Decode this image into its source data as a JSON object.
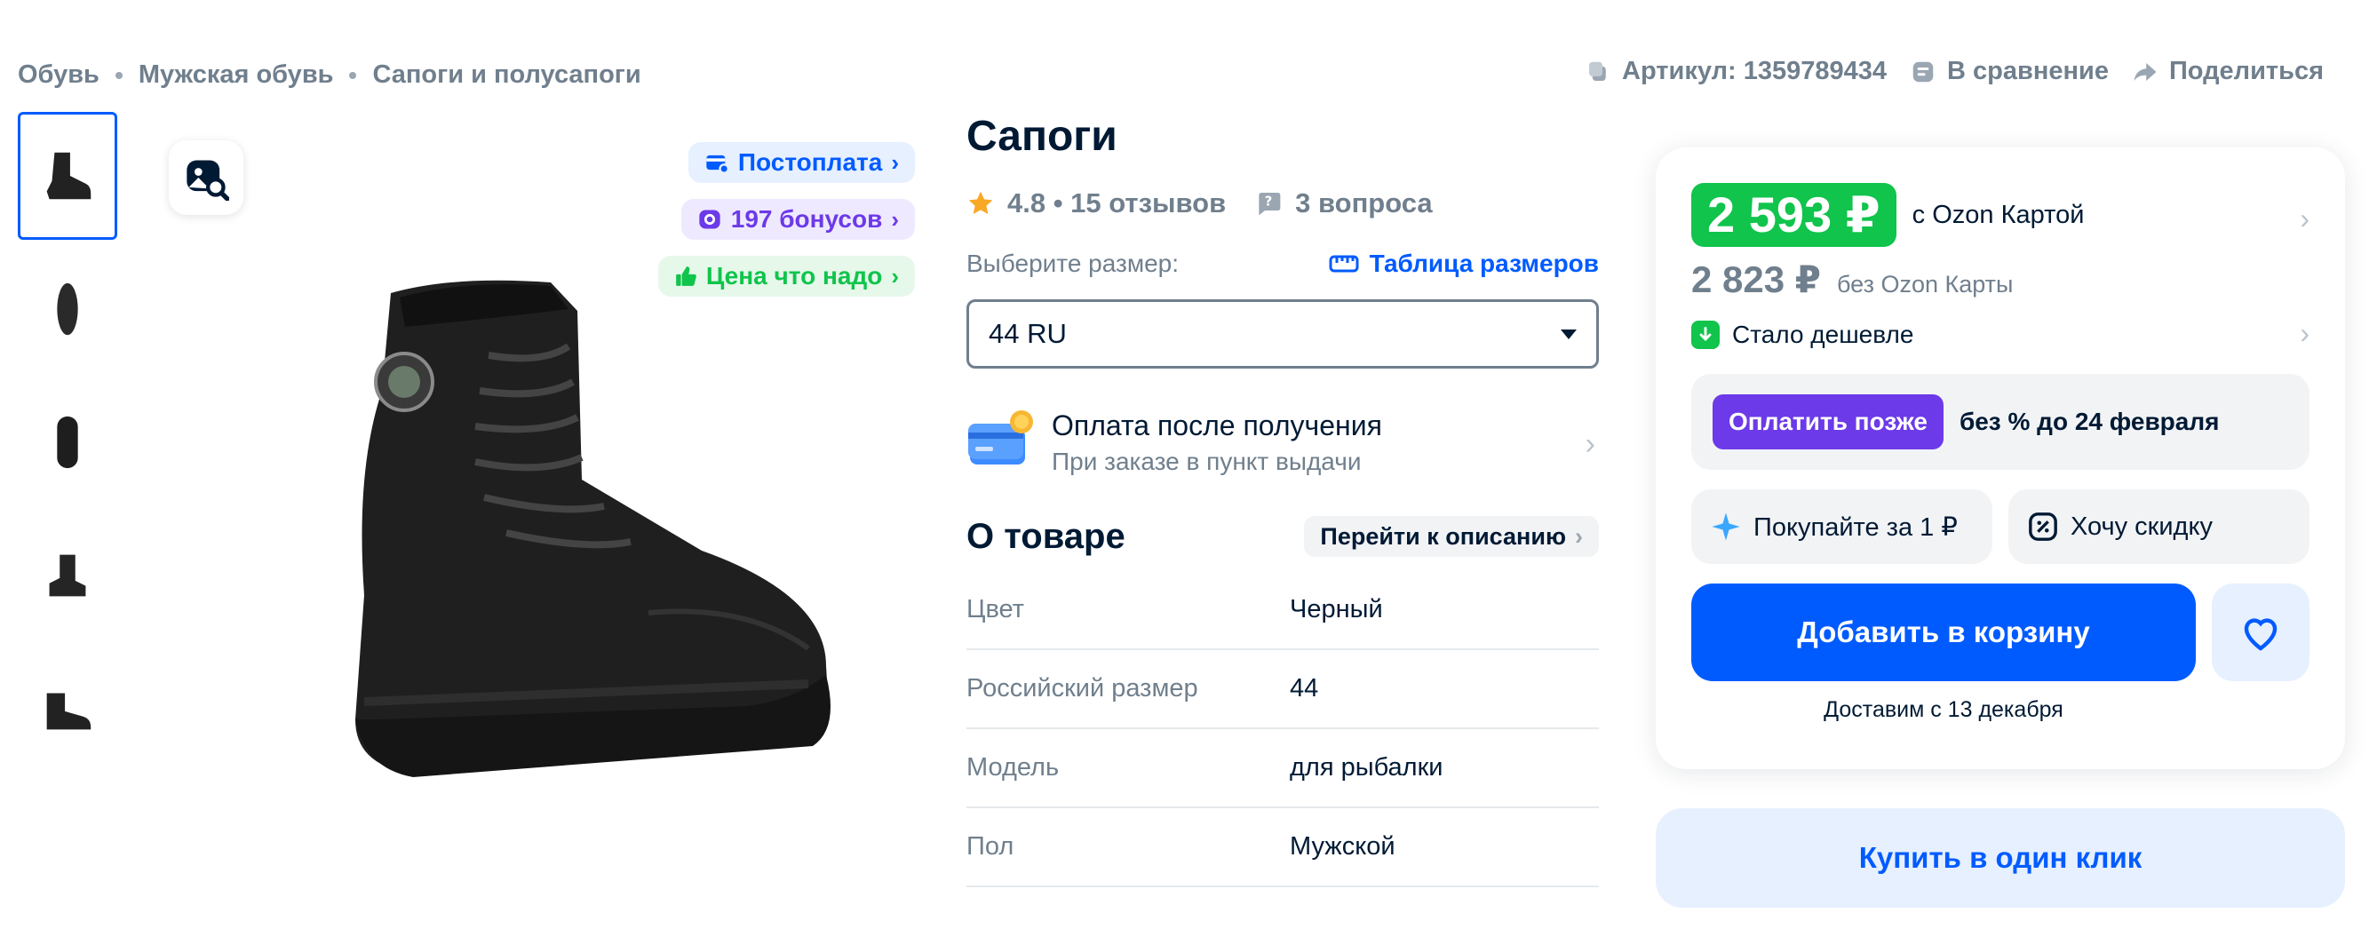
{
  "breadcrumbs": [
    "Обувь",
    "Мужская обувь",
    "Сапоги и полусапоги"
  ],
  "top_actions": {
    "article": "Артикул: 1359789434",
    "compare": "В сравнение",
    "share": "Поделиться"
  },
  "badges": {
    "postpay": "Постоплата",
    "bonuses": "197 бонусов",
    "price_ok": "Цена что надо"
  },
  "product": {
    "title": "Сапоги",
    "rating": "4.8 • 15 отзывов",
    "questions": "3 вопроса",
    "size_label": "Выберите размер:",
    "size_table": "Таблица размеров",
    "size_selected": "44 RU",
    "pay_title": "Оплата после получения",
    "pay_sub": "При заказе в пункт выдачи",
    "about": "О товаре",
    "goto_desc": "Перейти к описанию",
    "specs": [
      {
        "k": "Цвет",
        "v": "Черный"
      },
      {
        "k": "Российский размер",
        "v": "44"
      },
      {
        "k": "Модель",
        "v": "для рыбалки"
      },
      {
        "k": "Пол",
        "v": "Мужской"
      }
    ]
  },
  "price": {
    "card_price": "2 593 ₽",
    "card_note": "с Ozon Картой",
    "regular_price": "2 823 ₽",
    "regular_note": "без Ozon Карты",
    "cheaper": "Стало дешевле",
    "pay_later_btn": "Оплатить позже",
    "pay_later_txt": "без % до 24 февраля",
    "buy_for": "Покупайте за 1 ₽",
    "want_discount": "Хочу скидку",
    "add_to_cart": "Добавить в корзину",
    "delivery": "Доставим с 13 декабря",
    "one_click": "Купить в один клик"
  },
  "colors": {
    "accent": "#005bff",
    "green": "#10c44c",
    "violet": "#6c3ae8"
  }
}
